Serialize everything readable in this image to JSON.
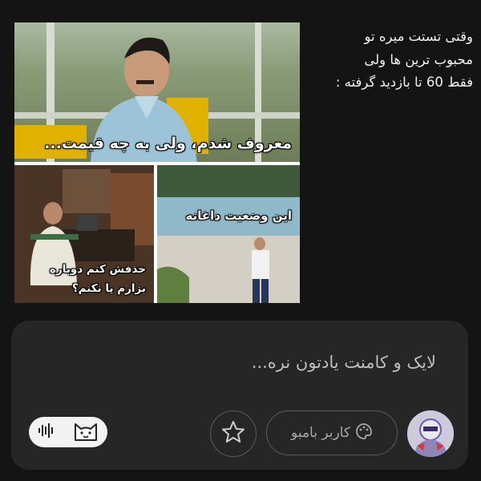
{
  "meme": {
    "top_caption": "معروف شدم، ولی به چه قیمت...",
    "bottom_right_caption": "این وضعیت داغانه",
    "bottom_left_caption_line1": "حذفش کنم دوباره",
    "bottom_left_caption_line2": "بزارم یا نکنم؟"
  },
  "side_text": {
    "line1": "وقتی تستت میره تو",
    "line2": "محبوب ترین ها ولی",
    "line3": "فقط 60 تا بازدید گرفته :"
  },
  "composer": {
    "placeholder": "لایک و کامنت یادتون نره...",
    "user_label": "کاربر بامبو",
    "icons": {
      "voice": "voice-wave-icon",
      "cat": "cat-face-icon",
      "star": "star-icon",
      "palette": "palette-icon"
    }
  },
  "colors": {
    "background": "#141414",
    "composer_bg": "#262626",
    "pill_bg": "#f2f2f2"
  }
}
